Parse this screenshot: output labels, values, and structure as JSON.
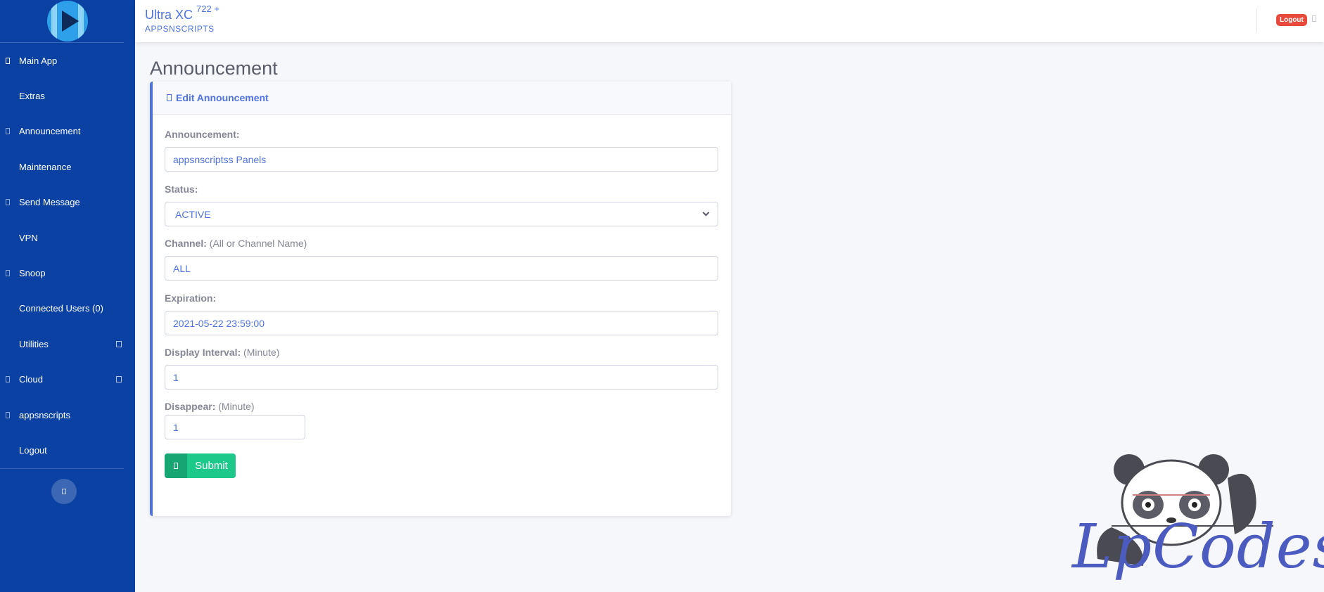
{
  "sidebar": {
    "items": [
      {
        "label": "Main App",
        "icon": "list-icon"
      },
      {
        "label": "Extras",
        "icon": ""
      },
      {
        "label": "Announcement",
        "icon": "bullhorn-icon"
      },
      {
        "label": "Maintenance",
        "icon": ""
      },
      {
        "label": "Send Message",
        "icon": "message-icon"
      },
      {
        "label": "VPN",
        "icon": ""
      },
      {
        "label": "Snoop",
        "icon": "eye-icon"
      },
      {
        "label": "Connected Users (0)",
        "icon": ""
      },
      {
        "label": "Utilities",
        "icon": ""
      },
      {
        "label": "Cloud",
        "icon": "cloud-icon"
      },
      {
        "label": "appsnscripts",
        "icon": "user-icon"
      },
      {
        "label": "Logout",
        "icon": ""
      }
    ]
  },
  "topbar": {
    "app_name": "Ultra XC",
    "version": "722 +",
    "subtitle": "APPSNSCRIPTS",
    "logout_label": "Logout"
  },
  "main": {
    "page_title": "Announcement",
    "card_title": "Edit Announcement",
    "form": {
      "announcement_label": "Announcement:",
      "announcement_value": "appsnscriptss Panels",
      "status_label": "Status:",
      "status_value": "ACTIVE",
      "channel_label": "Channel:",
      "channel_hint": "(All or Channel Name)",
      "channel_value": "ALL",
      "expiration_label": "Expiration:",
      "expiration_value": "2021-05-22 23:59:00",
      "interval_label": "Display Interval:",
      "interval_hint": "(Minute)",
      "interval_value": "1",
      "disappear_label": "Disappear:",
      "disappear_hint": "(Minute)",
      "disappear_value": "1",
      "submit_label": "Submit"
    }
  },
  "watermark": {
    "text": "LpCodes"
  },
  "colors": {
    "sidebar": "#0a41a3",
    "accent": "#4e73df",
    "success": "#1cc88a",
    "danger": "#e74a3b"
  }
}
